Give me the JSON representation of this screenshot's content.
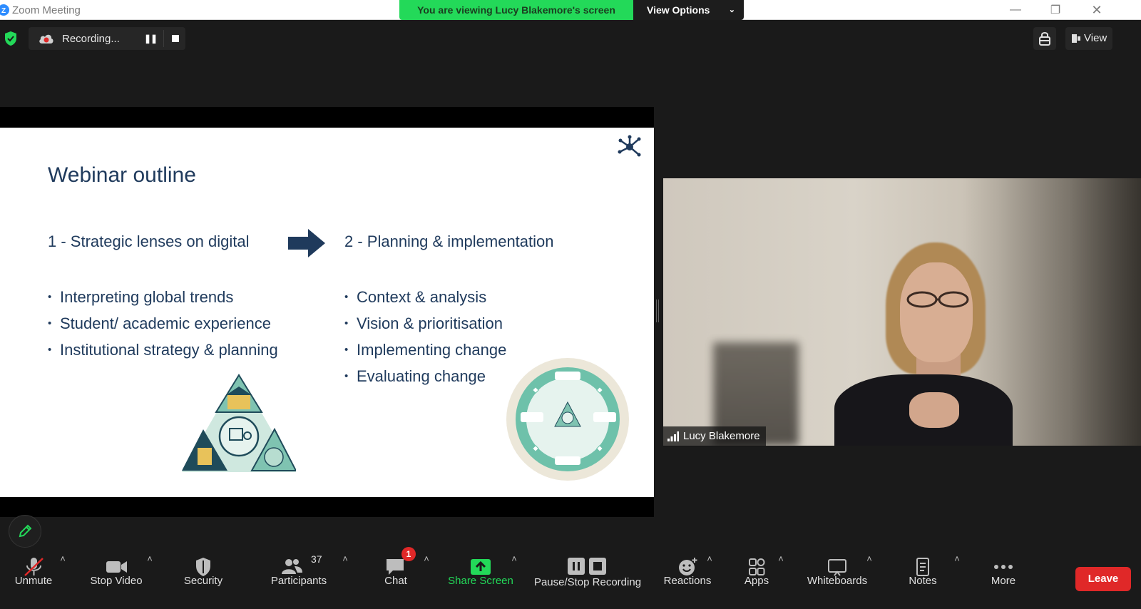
{
  "window": {
    "title": "Zoom Meeting",
    "viewing_message": "You are viewing Lucy Blakemore's screen",
    "view_options_label": "View Options",
    "controls": {
      "minimize": "—",
      "restore": "❐",
      "close": "✕"
    }
  },
  "recording": {
    "label": "Recording...",
    "pause_symbol": "❚❚"
  },
  "top_right": {
    "view_label": "View"
  },
  "slide": {
    "title": "Webinar outline",
    "left_heading": "1 - Strategic lenses on digital",
    "right_heading": "2 - Planning & implementation",
    "left_bullets": [
      "Interpreting global trends",
      "Student/ academic experience",
      "Institutional strategy & planning"
    ],
    "right_bullets": [
      "Context & analysis",
      "Vision & prioritisation",
      "Implementing change",
      "Evaluating change"
    ]
  },
  "video": {
    "participant_name": "Lucy Blakemore"
  },
  "toolbar": {
    "unmute": "Unmute",
    "stop_video": "Stop Video",
    "security": "Security",
    "participants": "Participants",
    "participant_count": "37",
    "chat": "Chat",
    "chat_badge": "1",
    "share_screen": "Share Screen",
    "pause_stop_recording": "Pause/Stop Recording",
    "reactions": "Reactions",
    "apps": "Apps",
    "whiteboards": "Whiteboards",
    "notes": "Notes",
    "more": "More",
    "leave": "Leave",
    "caret": "˄"
  },
  "colors": {
    "banner_green": "#23d959",
    "leave_red": "#e02828",
    "slide_navy": "#1f3a5c",
    "share_green": "#23d959"
  }
}
